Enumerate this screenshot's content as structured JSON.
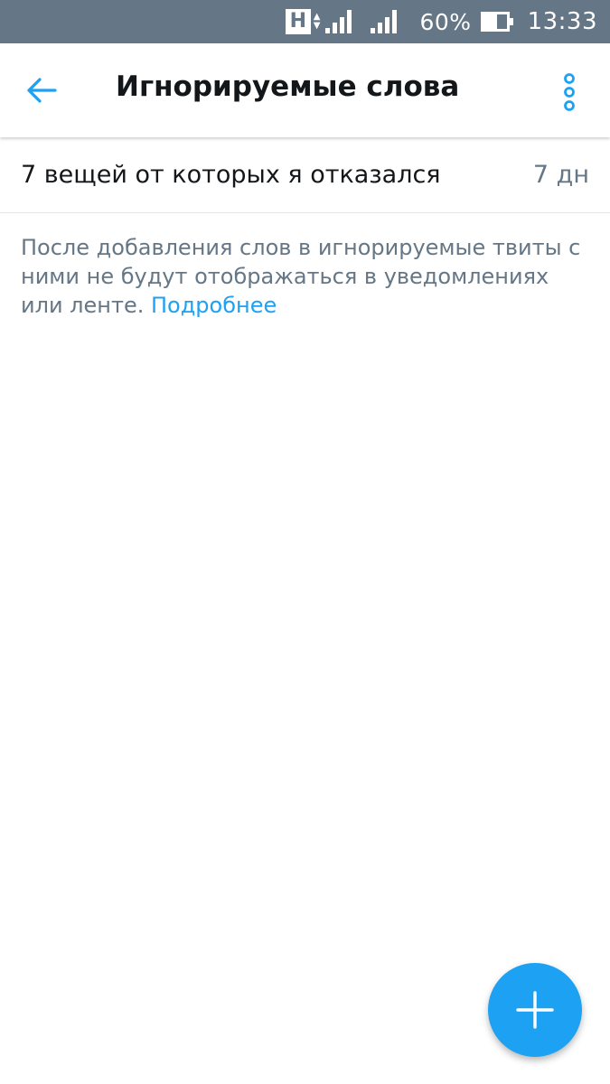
{
  "status_bar": {
    "network_letter": "H",
    "battery_percent": "60%",
    "battery_level": 0.6,
    "time": "13:33"
  },
  "header": {
    "title": "Игнорируемые слова",
    "back_icon": "arrow-left-icon",
    "more_icon": "more-vertical-icon"
  },
  "muted_words": [
    {
      "word": "7 вещей от которых я отказался",
      "duration": "7 дн"
    }
  ],
  "info": {
    "text": "После добавления слов в игнорируемые твиты с ними не будут отображаться в уведомлениях или ленте.",
    "link": "Подробнее"
  },
  "fab": {
    "icon": "plus-icon"
  },
  "colors": {
    "accent": "#1da1f2",
    "status_bar": "#657786",
    "secondary_text": "#657786",
    "primary_text": "#14171a",
    "divider": "#e1e8ed"
  }
}
